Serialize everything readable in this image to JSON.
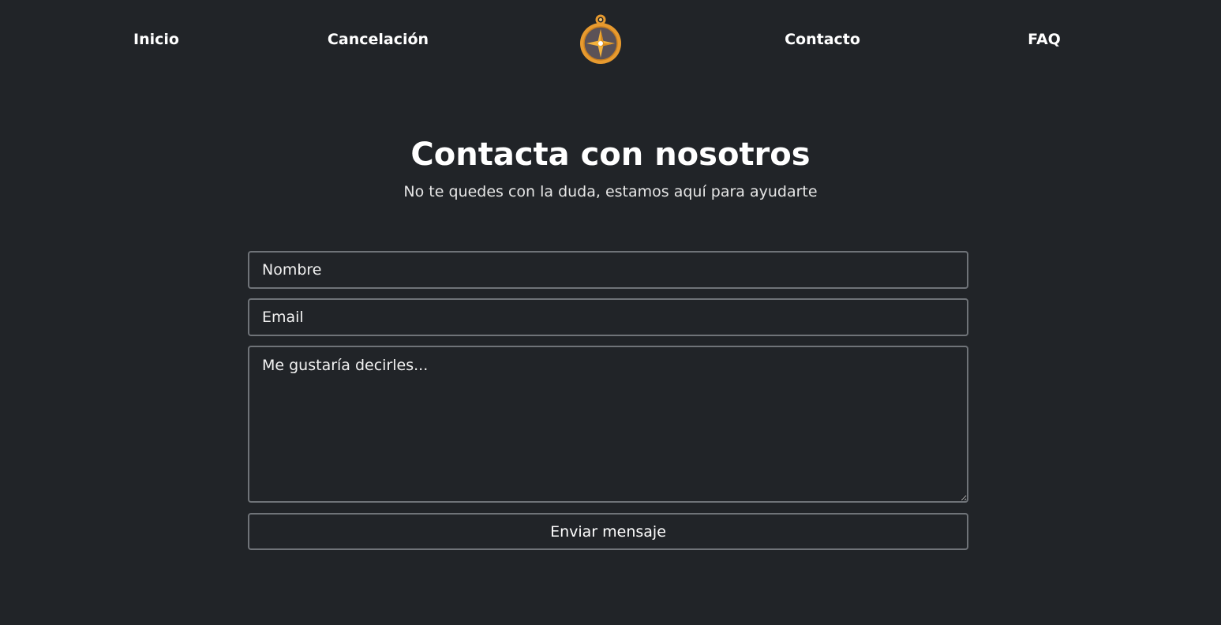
{
  "nav": {
    "items": [
      {
        "label": "Inicio"
      },
      {
        "label": "Cancelación"
      },
      {
        "label": "Contacto"
      },
      {
        "label": "FAQ"
      }
    ],
    "logo_icon": "compass-icon"
  },
  "hero": {
    "title": "Contacta con nosotros",
    "subtitle": "No te quedes con la duda, estamos aquí para ayudarte"
  },
  "form": {
    "name_placeholder": "Nombre",
    "email_placeholder": "Email",
    "message_placeholder": "Me gustaría decirles...",
    "submit_label": "Enviar mensaje"
  },
  "colors": {
    "background": "#212428",
    "border": "#6f7378",
    "accent": "#e79a2f"
  }
}
